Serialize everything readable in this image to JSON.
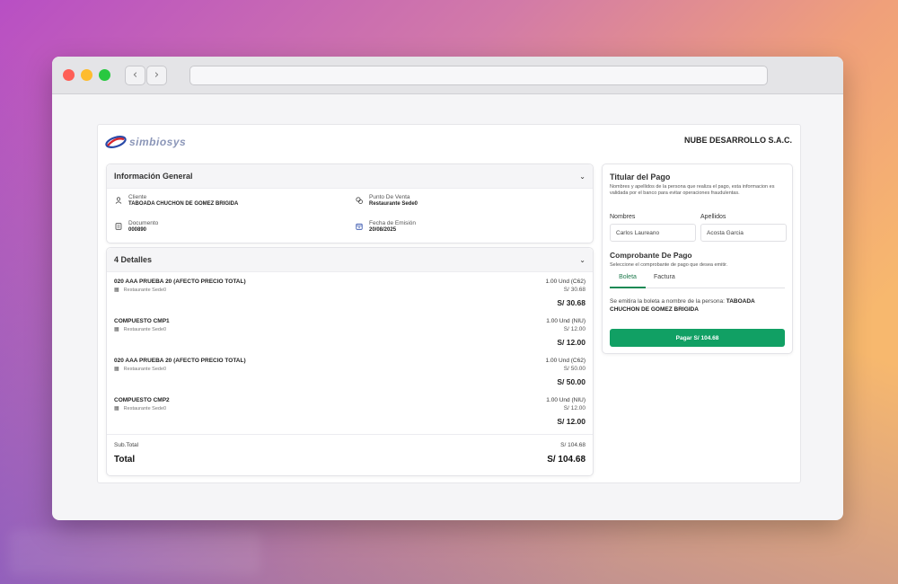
{
  "brand": {
    "logo_text": "simbiosys",
    "company": "NUBE DESARROLLO S.A.C."
  },
  "info": {
    "title": "Información General",
    "cliente_label": "Cliente",
    "cliente_value": "TABOADA CHUCHON DE GOMEZ BRIGIDA",
    "pv_label": "Punto De Venta",
    "pv_value": "Restaurante Sede0",
    "doc_label": "Documento",
    "doc_value": "000890",
    "fecha_label": "Fecha de Emisión",
    "fecha_value": "20/08/2025"
  },
  "details": {
    "title": "4 Detalles",
    "items": [
      {
        "name": "020 AAA PRUEBA 20 (AFECTO PRECIO TOTAL)",
        "store": "Restaurante Sede0",
        "qty": "1.00 Und (C62)",
        "unit": "S/ 30.68",
        "total": "S/ 30.68"
      },
      {
        "name": "COMPUESTO CMP1",
        "store": "Restaurante Sede0",
        "qty": "1.00 Und (NIU)",
        "unit": "S/ 12.00",
        "total": "S/ 12.00"
      },
      {
        "name": "020 AAA PRUEBA 20 (AFECTO PRECIO TOTAL)",
        "store": "Restaurante Sede0",
        "qty": "1.00 Und (C62)",
        "unit": "S/ 50.00",
        "total": "S/ 50.00"
      },
      {
        "name": "COMPUESTO CMP2",
        "store": "Restaurante Sede0",
        "qty": "1.00 Und (NIU)",
        "unit": "S/ 12.00",
        "total": "S/ 12.00"
      }
    ],
    "subtotal_label": "Sub.Total",
    "subtotal_value": "S/ 104.68",
    "total_label": "Total",
    "total_value": "S/ 104.68"
  },
  "payment": {
    "title": "Titular del Pago",
    "desc": "Nombres y apellidos de la persona que realiza el pago, esta informacion es validada por el banco para evitar operaciones fraudulentas.",
    "nombres_label": "Nombres",
    "nombres_value": "Carlos Laureano",
    "apellidos_label": "Apellidos",
    "apellidos_value": "Acosta Garcia",
    "comp_title": "Comprobante De Pago",
    "comp_desc": "Seleccione el comprobante de pago que desea emitir.",
    "tab_boleta": "Boleta",
    "tab_factura": "Factura",
    "msg_prefix": "Se emitira la boleta a nombre de la persona:",
    "msg_name": "TABOADA CHUCHON DE GOMEZ BRIGIDA",
    "pay_button": "Pagar S/ 104.68"
  },
  "icons": {
    "back": "chevron-left-icon",
    "forward": "chevron-right-icon",
    "user": "user-icon",
    "store": "store-icon",
    "document": "document-icon",
    "calendar": "calendar-icon"
  },
  "colors": {
    "accent": "#11a064",
    "tab_active": "#1f7a4d"
  }
}
